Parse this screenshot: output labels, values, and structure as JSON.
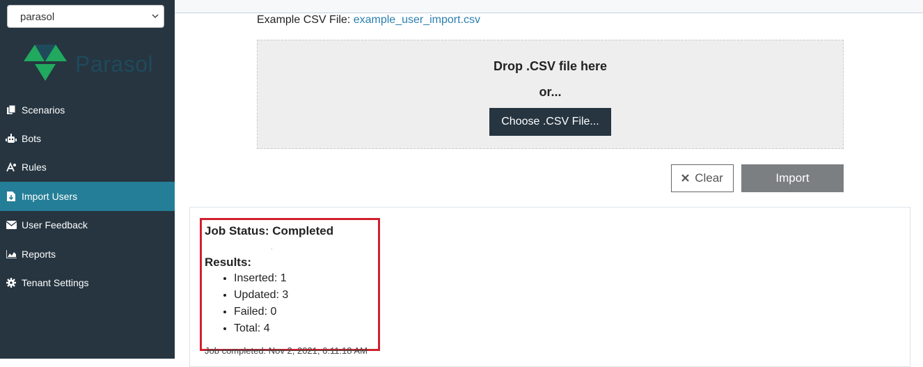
{
  "sidebar": {
    "tenant_select": "parasol",
    "logo_text": "Parasol",
    "items": [
      {
        "label": "Scenarios",
        "icon": "copy-icon"
      },
      {
        "label": "Bots",
        "icon": "robot-icon"
      },
      {
        "label": "Rules",
        "icon": "rules-icon"
      },
      {
        "label": "Import Users",
        "icon": "file-import-icon"
      },
      {
        "label": "User Feedback",
        "icon": "envelope-icon"
      },
      {
        "label": "Reports",
        "icon": "chart-area-icon"
      },
      {
        "label": "Tenant Settings",
        "icon": "gear-icon"
      }
    ],
    "active_item": "Import Users"
  },
  "main": {
    "example_label": "Example CSV File: ",
    "example_link": "example_user_import.csv",
    "dropzone": {
      "title": "Drop .CSV file here",
      "or": "or...",
      "choose_button": "Choose .CSV File..."
    },
    "clear_button": "Clear",
    "import_button": "Import",
    "results": {
      "job_status": "Job Status: Completed",
      "results_label": "Results:",
      "items": [
        "Inserted: 1",
        "Updated: 3",
        "Failed: 0",
        "Total: 4"
      ],
      "completed_at": "Job completed: Nov 2, 2021, 6:11:18 AM"
    }
  },
  "colors": {
    "sidebar_bg": "#263540",
    "active_item_bg": "#257e97",
    "link": "#2a7fae",
    "highlight": "#d0202e"
  }
}
